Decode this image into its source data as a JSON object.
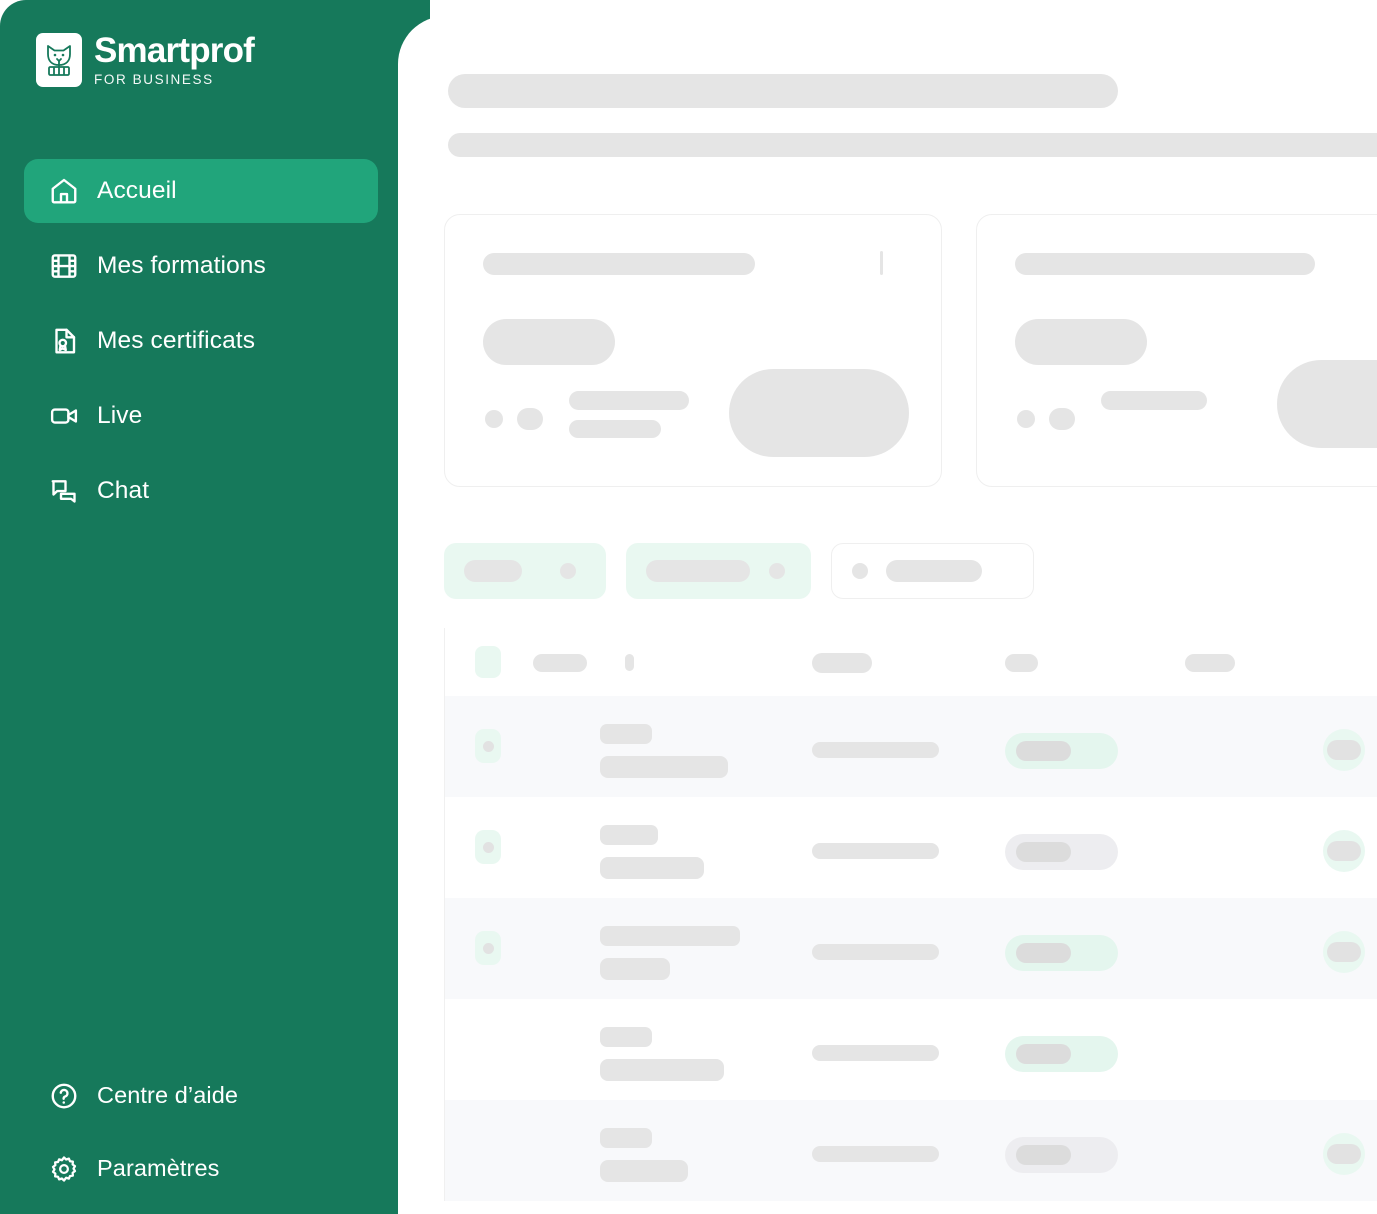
{
  "brand": {
    "name": "Smartprof",
    "tagline": "FOR BUSINESS",
    "logo_icon": "fox-head-logo-icon",
    "sidebar_color": "#16795b",
    "active_color": "#21a57b"
  },
  "sidebar": {
    "items": [
      {
        "label": "Accueil",
        "icon": "home-icon",
        "active": true
      },
      {
        "label": "Mes formations",
        "icon": "film-strip-icon",
        "active": false
      },
      {
        "label": "Mes certificats",
        "icon": "certificate-icon",
        "active": false
      },
      {
        "label": "Live",
        "icon": "video-camera-icon",
        "active": false
      },
      {
        "label": "Chat",
        "icon": "chat-bubbles-icon",
        "active": false
      }
    ],
    "bottom_items": [
      {
        "label": "Centre d’aide",
        "icon": "question-circle-icon"
      },
      {
        "label": "Paramètres",
        "icon": "gear-icon"
      }
    ]
  },
  "main": {
    "state": "loading-skeleton",
    "header": {
      "title_placeholder": "",
      "subtitle_placeholder": ""
    },
    "cards": [
      {
        "id": "card-a",
        "lines": 2
      },
      {
        "id": "card-b",
        "lines": 1
      }
    ],
    "chips": [
      {
        "id": "chip-1",
        "style": "mint"
      },
      {
        "id": "chip-2",
        "style": "mint"
      },
      {
        "id": "chip-3",
        "style": "plain"
      }
    ],
    "table": {
      "columns": [
        "select",
        "name",
        "detail",
        "status",
        "action"
      ],
      "rows": [
        {
          "alt": true,
          "checkbox": true,
          "name_w": 52,
          "name2_w": 128,
          "mid_w": 127,
          "badge": "mint",
          "circle": true
        },
        {
          "alt": false,
          "checkbox": true,
          "name_w": 58,
          "name2_w": 104,
          "mid_w": 127,
          "badge": "gray",
          "circle": true
        },
        {
          "alt": true,
          "checkbox": true,
          "name_w": 140,
          "name2_w": 70,
          "mid_w": 127,
          "badge": "mint",
          "circle": true
        },
        {
          "alt": false,
          "checkbox": false,
          "name_w": 52,
          "name2_w": 124,
          "mid_w": 127,
          "badge": "mint",
          "circle": false
        },
        {
          "alt": true,
          "checkbox": false,
          "name_w": 52,
          "name2_w": 88,
          "mid_w": 127,
          "badge": "gray",
          "circle": true
        }
      ]
    }
  },
  "palette": {
    "skeleton": "#e5e5e5",
    "mint": "#e9f8f1",
    "row_alt": "#f8f9fb",
    "card_border": "#efefef"
  }
}
